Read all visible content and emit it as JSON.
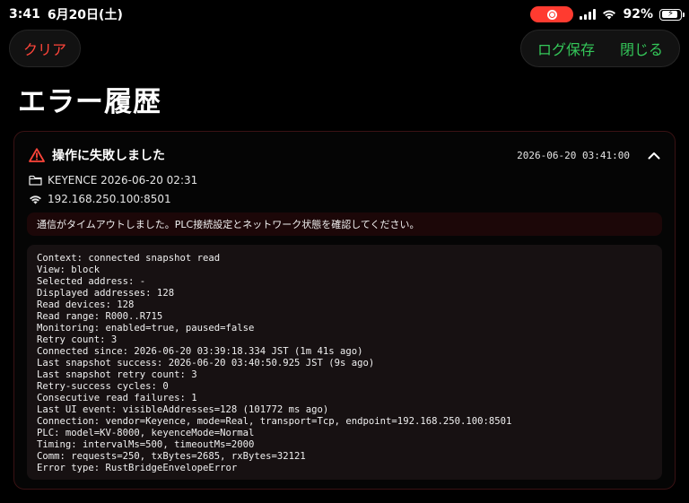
{
  "status_bar": {
    "time": "3:41",
    "date": "6月20日(土)",
    "battery_percent": "92%",
    "battery_level": 0.92,
    "recording_color": "#ff3b30"
  },
  "toolbar": {
    "clear_label": "クリア",
    "save_log_label": "ログ保存",
    "close_label": "閉じる",
    "danger_color": "#ff453a",
    "accent_color": "#34c759"
  },
  "page": {
    "title": "エラー履歴"
  },
  "error_entry": {
    "title": "操作に失敗しました",
    "timestamp": "2026-06-20 03:41:00",
    "expanded": true,
    "icons": {
      "warning": "warning-triangle-icon",
      "collapse": "chevron-up-icon",
      "device": "folder-icon",
      "network": "wifi-icon"
    },
    "device": "KEYENCE 2026-06-20 02:31",
    "address": "192.168.250.100:8501",
    "message": "通信がタイムアウトしました。PLC接続設定とネットワーク状態を確認してください。",
    "details": [
      "Context: connected snapshot read",
      "View: block",
      "Selected address: -",
      "Displayed addresses: 128",
      "Read devices: 128",
      "Read range: R000..R715",
      "Monitoring: enabled=true, paused=false",
      "Retry count: 3",
      "Connected since: 2026-06-20 03:39:18.334 JST (1m 41s ago)",
      "Last snapshot success: 2026-06-20 03:40:50.925 JST (9s ago)",
      "Last snapshot retry count: 3",
      "Retry-success cycles: 0",
      "Consecutive read failures: 1",
      "Last UI event: visibleAddresses=128 (101772 ms ago)",
      "Connection: vendor=Keyence, mode=Real, transport=Tcp, endpoint=192.168.250.100:8501",
      "PLC: model=KV-8000, keyenceMode=Normal",
      "Timing: intervalMs=500, timeoutMs=2000",
      "Comm: requests=250, txBytes=2685, rxBytes=32121",
      "Error type: RustBridgeEnvelopeError"
    ]
  }
}
